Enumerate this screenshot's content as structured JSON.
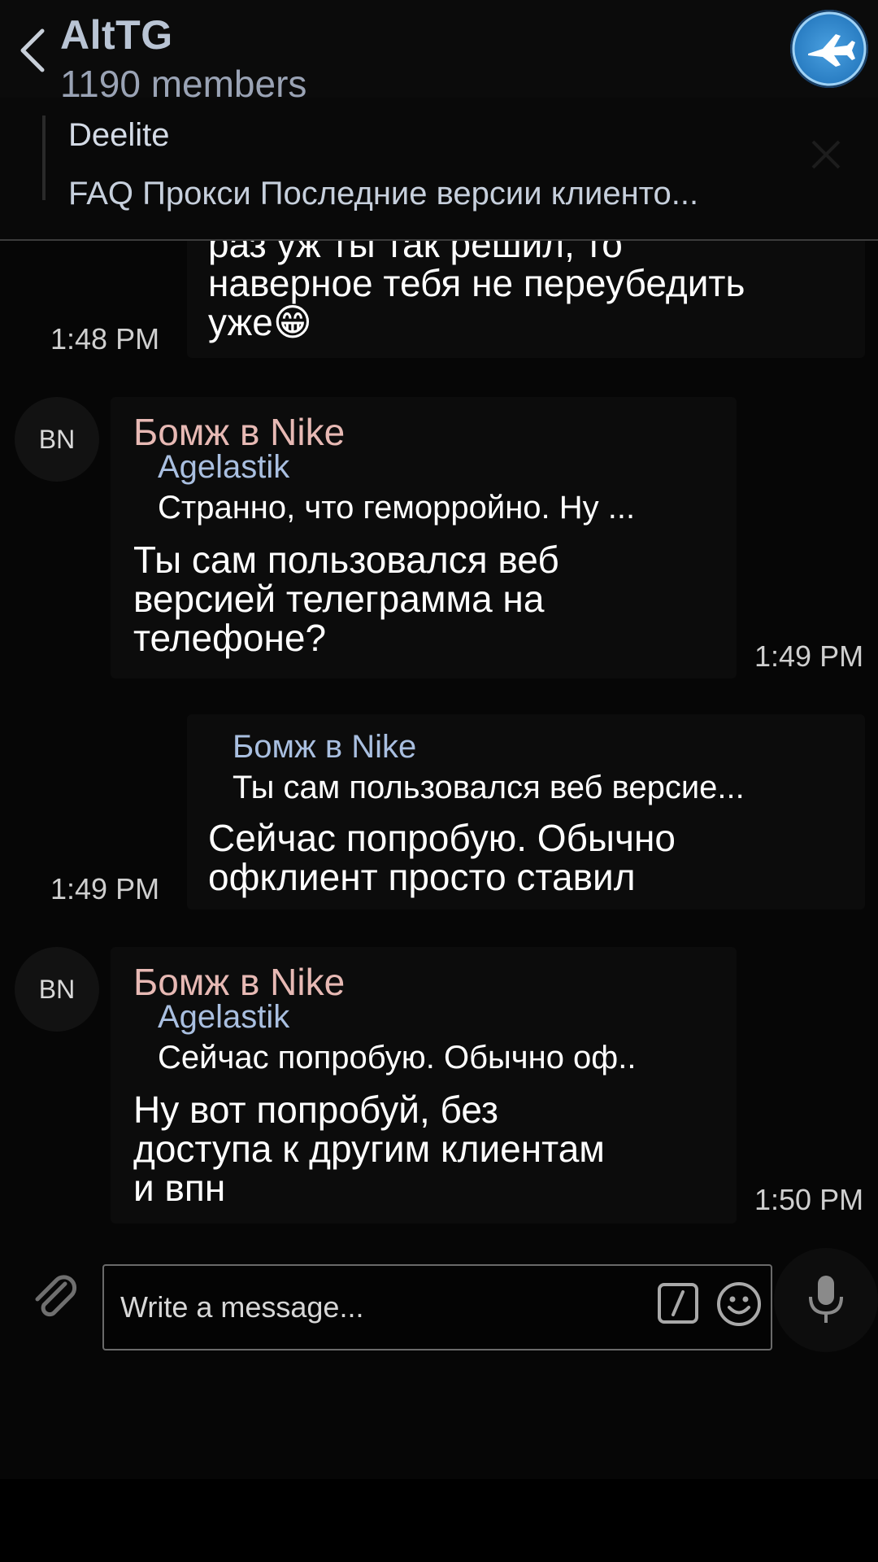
{
  "header": {
    "title": "AltTG",
    "subtitle": "1190 members"
  },
  "pinned": {
    "title": "Deelite",
    "text": "FAQ Прокси Последние версии клиенто..."
  },
  "messages": [
    {
      "direction": "out",
      "text": "раз уж ты так решил, то\nнаверное тебя не переубедить\nуже😁",
      "time": "1:48 PM"
    },
    {
      "direction": "in",
      "avatar": "BN",
      "sender": "Бомж в Nike",
      "reply_name": "Agelastik",
      "reply_text": "Странно, что геморройно. Ну ...",
      "text": "Ты сам пользовался веб\nверсией телеграмма на\nтелефоне?",
      "time": "1:49 PM"
    },
    {
      "direction": "out",
      "reply_name": "Бомж в Nike",
      "reply_text": "Ты сам пользовался веб версие...",
      "text": "Сейчас попробую. Обычно\nофклиент просто ставил",
      "time": "1:49 PM"
    },
    {
      "direction": "in",
      "avatar": "BN",
      "sender": "Бомж в Nike",
      "reply_name": "Agelastik",
      "reply_text": "Сейчас попробую. Обычно оф..",
      "text": "Ну вот попробуй, без\nдоступа к другим клиентам\nи впн",
      "time": "1:50 PM"
    }
  ],
  "composer": {
    "placeholder": "Write a message..."
  },
  "icons": {
    "back": "chevron-left-icon",
    "logo": "plane-logo-icon",
    "close": "close-icon",
    "attach": "paperclip-icon",
    "command": "slash-command-icon",
    "emoji": "smiley-icon",
    "mic": "microphone-icon"
  }
}
